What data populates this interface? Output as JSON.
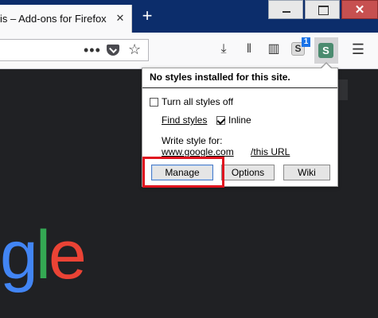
{
  "window": {
    "tab_title": "is – Add-ons for Firefox",
    "tab_close_glyph": "✕",
    "new_tab_glyph": "+",
    "minimize_icon": "minimize-icon",
    "maximize_icon": "maximize-icon",
    "close_glyph": "✕"
  },
  "toolbar": {
    "page_actions_glyph": "•••",
    "star_glyph": "☆",
    "download_glyph": "⤓",
    "library_glyph": "𝍪",
    "sidebar_glyph": "▥",
    "stylish_letter": "S",
    "stylish_badge": "1",
    "stylish_active_letter": "S",
    "menu_glyph": "☰"
  },
  "popup": {
    "header": "No styles installed for this site.",
    "turn_off_label": "Turn all styles off",
    "turn_off_checked": false,
    "find_styles": "Find styles",
    "inline_label": "Inline",
    "inline_checked": true,
    "write_style_for": "Write style for:",
    "domain_link": "www.google.com",
    "this_url_link": "/this URL",
    "buttons": {
      "manage": "Manage",
      "options": "Options",
      "wiki": "Wiki"
    }
  },
  "page": {
    "logo_parts": [
      "g",
      "l",
      "e"
    ]
  },
  "colors": {
    "highlight": "#e0141f",
    "titlebar": "#0c2d6b",
    "google_blue": "#4285f4",
    "google_green": "#34a853",
    "google_red": "#ea4335"
  }
}
